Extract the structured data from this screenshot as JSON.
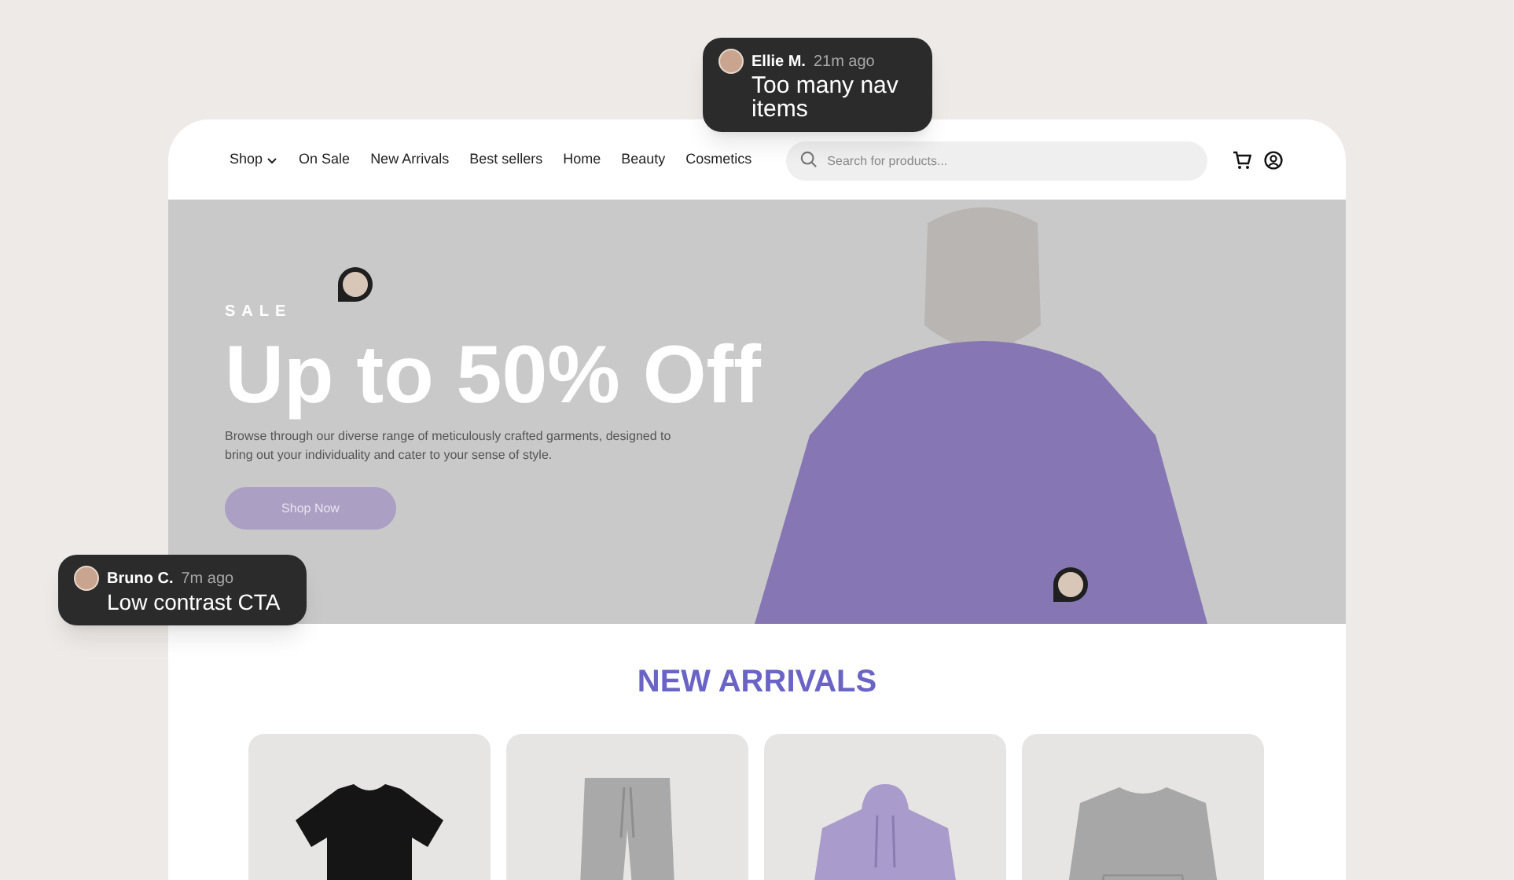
{
  "nav": {
    "items": [
      {
        "label": "Shop",
        "dropdown": true
      },
      {
        "label": "On Sale",
        "dropdown": false
      },
      {
        "label": "New Arrivals",
        "dropdown": false
      },
      {
        "label": "Best sellers",
        "dropdown": false
      },
      {
        "label": "Home",
        "dropdown": false
      },
      {
        "label": "Beauty",
        "dropdown": false
      },
      {
        "label": "Cosmetics",
        "dropdown": false
      }
    ],
    "search": {
      "placeholder": "Search for products..."
    }
  },
  "hero": {
    "eyebrow": "SALE",
    "title": "Up to 50% Off",
    "description": "Browse through our diverse range of meticulously crafted garments, designed to bring out your individuality and cater to your sense of style.",
    "button": "Shop Now"
  },
  "new_arrivals": {
    "title": "NEW ARRIVALS",
    "products": [
      {
        "kind": "tshirt"
      },
      {
        "kind": "pants"
      },
      {
        "kind": "hoodie"
      },
      {
        "kind": "sweatshirt"
      }
    ]
  },
  "comments": [
    {
      "author": "Ellie M.",
      "time": "21m ago",
      "text": "Too many nav items"
    },
    {
      "author": "Bruno C.",
      "time": "7m ago",
      "text": "Low contrast CTA"
    }
  ]
}
